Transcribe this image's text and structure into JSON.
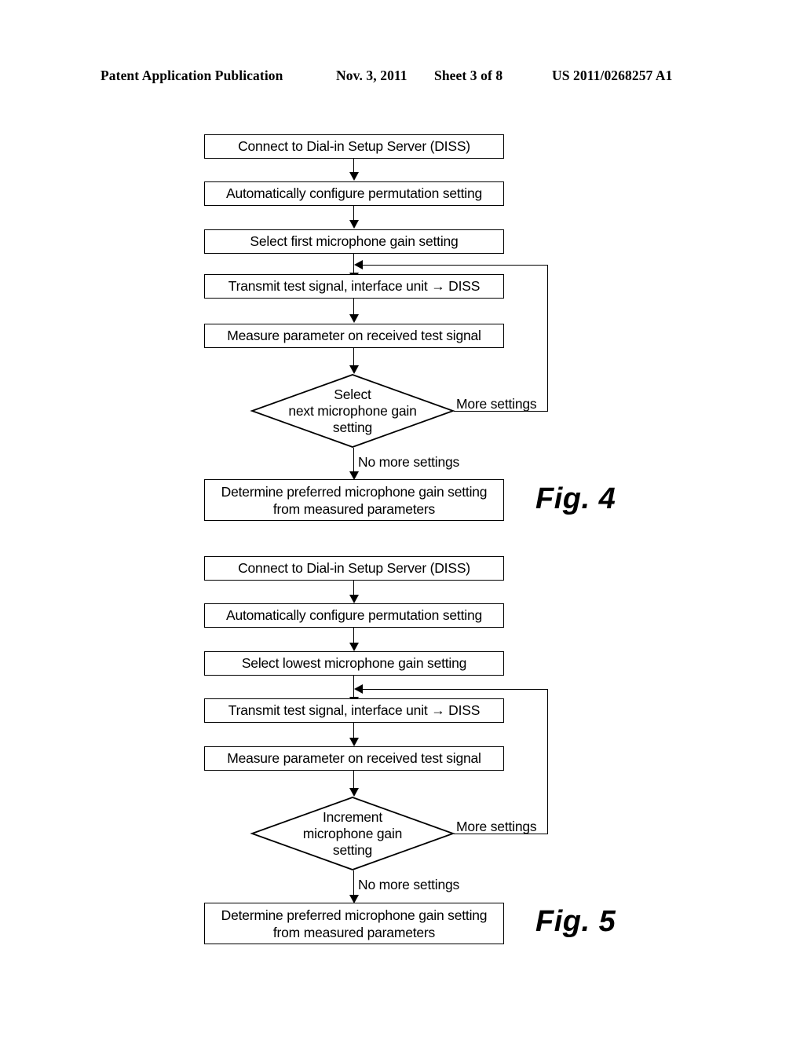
{
  "header": {
    "publication": "Patent Application Publication",
    "date": "Nov. 3, 2011",
    "sheet": "Sheet 3 of 8",
    "patent_number": "US 2011/0268257 A1"
  },
  "figures": [
    {
      "caption": "Fig. 4",
      "steps": [
        {
          "id": "connect",
          "label": "Connect to Dial-in Setup Server (DISS)"
        },
        {
          "id": "configure",
          "label": "Automatically configure permutation setting"
        },
        {
          "id": "select",
          "label": "Select first microphone gain setting"
        },
        {
          "id": "transmit",
          "label": "Transmit test signal, interface unit → DISS"
        },
        {
          "id": "measure",
          "label": "Measure parameter on received test signal"
        }
      ],
      "decision": {
        "id": "select-next-gain",
        "line1": "Select",
        "line2": "next microphone gain",
        "line3": "setting",
        "branch_loop": "More settings",
        "branch_exit": "No more settings"
      },
      "result": {
        "id": "determine",
        "line1": "Determine preferred microphone gain setting",
        "line2": "from measured parameters"
      }
    },
    {
      "caption": "Fig. 5",
      "steps": [
        {
          "id": "connect",
          "label": "Connect to Dial-in Setup Server (DISS)"
        },
        {
          "id": "configure",
          "label": "Automatically configure permutation setting"
        },
        {
          "id": "select",
          "label": "Select lowest microphone gain setting"
        },
        {
          "id": "transmit",
          "label": "Transmit test signal, interface unit → DISS"
        },
        {
          "id": "measure",
          "label": "Measure parameter on received test signal"
        }
      ],
      "decision": {
        "id": "increment-gain",
        "line1": "Increment",
        "line2": "microphone gain",
        "line3": "setting",
        "branch_loop": "More settings",
        "branch_exit": "No more settings"
      },
      "result": {
        "id": "determine",
        "line1": "Determine preferred microphone gain setting",
        "line2": "from measured parameters"
      }
    }
  ],
  "colors": {
    "ink": "#000000",
    "paper": "#ffffff"
  }
}
